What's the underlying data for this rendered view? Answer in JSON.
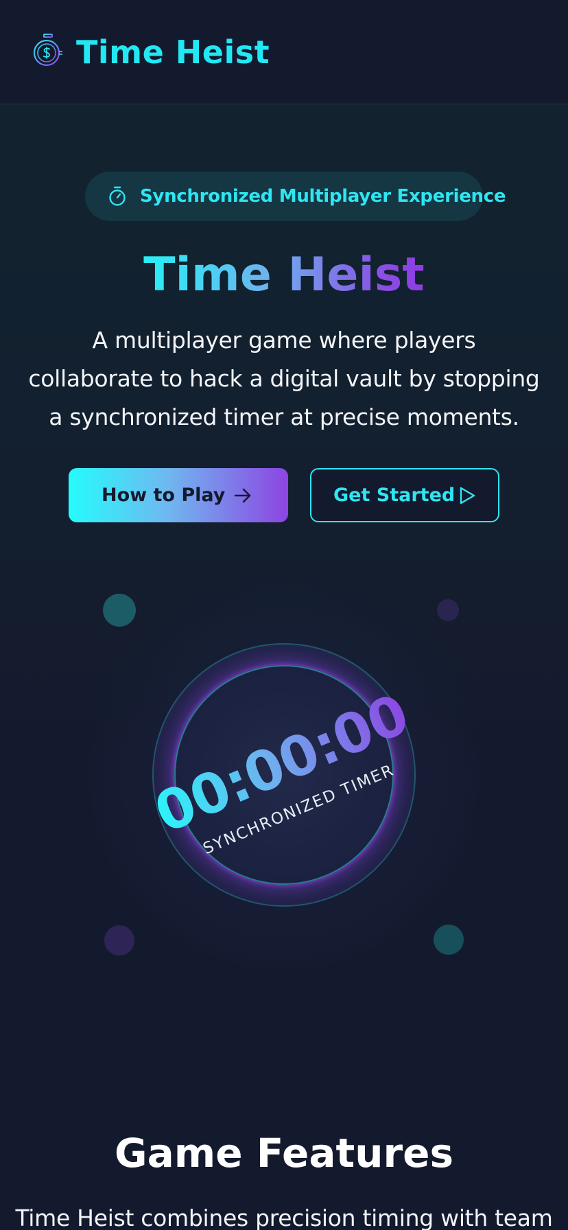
{
  "header": {
    "logo_icon": "stopwatch-dollar-icon",
    "brand": "Time Heist"
  },
  "hero": {
    "badge_icon": "stopwatch-icon",
    "badge_text": "Synchronized Multiplayer Experience",
    "title": "Time Heist",
    "description": "A multiplayer game where players collaborate to hack a digital vault by stopping a synchronized timer at precise moments.",
    "primary_button": {
      "label": "How to Play",
      "icon": "arrow-right-icon"
    },
    "secondary_button": {
      "label": "Get Started",
      "icon": "play-icon"
    }
  },
  "timer": {
    "value": "00:00:00",
    "label": "SYNCHRONIZED TIMER"
  },
  "features": {
    "title": "Game Features",
    "description": "Time Heist combines precision timing with team"
  },
  "colors": {
    "accent": "#2ee6f2",
    "purple": "#8d45e2",
    "background": "#141a2e"
  }
}
